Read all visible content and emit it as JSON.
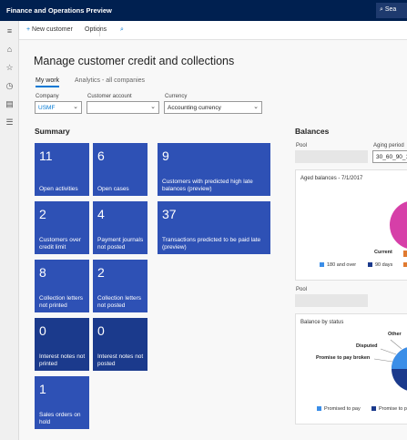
{
  "app": {
    "title": "Finance and Operations Preview",
    "search_label": "Sea"
  },
  "toolbar": {
    "new_customer": "New customer",
    "options": "Options"
  },
  "page": {
    "title": "Manage customer credit and collections",
    "tabs": [
      {
        "label": "My work"
      },
      {
        "label": "Analytics - all companies"
      }
    ]
  },
  "filters": {
    "company": {
      "label": "Company",
      "value": "USMF"
    },
    "customer_account": {
      "label": "Customer account",
      "value": ""
    },
    "currency": {
      "label": "Currency",
      "value": "Accounting currency"
    }
  },
  "summary": {
    "title": "Summary",
    "tiles": [
      {
        "count": "11",
        "label": "Open activities"
      },
      {
        "count": "6",
        "label": "Open cases"
      },
      {
        "count": "9",
        "label": "Customers with predicted high late balances (preview)"
      },
      {
        "count": "2",
        "label": "Customers over credit limit"
      },
      {
        "count": "4",
        "label": "Payment journals not posted"
      },
      {
        "count": "37",
        "label": "Transactions predicted to be paid late (preview)"
      },
      {
        "count": "8",
        "label": "Collection letters not printed"
      },
      {
        "count": "2",
        "label": "Collection letters not posted"
      },
      {
        "count": "0",
        "label": "Interest notes not printed"
      },
      {
        "count": "0",
        "label": "Interest notes not posted"
      },
      {
        "count": "1",
        "label": "Sales orders on hold"
      }
    ]
  },
  "balances": {
    "title": "Balances",
    "pool_label": "Pool",
    "aging_label": "Aging period",
    "aging_value": "30_60_90_1",
    "aged_card": {
      "title": "Aged balances - 7/1/2017",
      "slice_label": "Current",
      "legend": [
        {
          "label": "180 and over",
          "color": "#3b8ee8"
        },
        {
          "label": "90 days",
          "color": "#1b3a8c"
        },
        {
          "label": "",
          "color": "#e07a30"
        }
      ]
    },
    "pool2_label": "Pool",
    "status_card": {
      "title": "Balance by status",
      "labels": {
        "other": "Other",
        "disputed": "Disputed",
        "promise_broken": "Promise to pay broken"
      },
      "legend": [
        {
          "label": "Promised to pay",
          "color": "#3b8ee8"
        },
        {
          "label": "Promise to p",
          "color": "#1b3a8c"
        }
      ]
    }
  },
  "colors": {
    "topbar": "#002050",
    "tile": "#2e51b5",
    "tile_dark": "#1b3a8c",
    "accent": "#0078d4",
    "pie_magenta": "#d63fa8"
  }
}
